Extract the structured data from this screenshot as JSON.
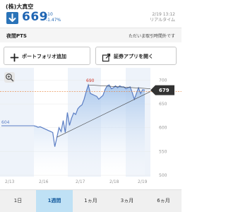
{
  "quote": {
    "company": "(株)大真空",
    "price": "669",
    "change": "-10",
    "change_pct": "-1.47%",
    "date_time": "2/19 13:12",
    "mode": "リアルタイム"
  },
  "pts": {
    "label": "夜間PTS",
    "status": "ただいま取引時間外です"
  },
  "buttons": {
    "portfolio": "ポートフォリオ追加",
    "app": "証券アプリを開く"
  },
  "chart_data": {
    "type": "line",
    "x_tick_labels": [
      "2/13",
      "2/16",
      "2/17",
      "2/18",
      "2/19"
    ],
    "y_tick_labels": [
      "700",
      "650",
      "600",
      "550",
      "500"
    ],
    "ylim": [
      500,
      720
    ],
    "series": [
      {
        "values": [
          604,
          603,
          601,
          602,
          600,
          598,
          596,
          594,
          592,
          590,
          560,
          580,
          600,
          592,
          615,
          590,
          632,
          605,
          620,
          631,
          628,
          640,
          645,
          648,
          660,
          676,
          690,
          672,
          670,
          668,
          666,
          660,
          664,
          668,
          680,
          688,
          690,
          682,
          684,
          688,
          684,
          688,
          686,
          686,
          682,
          684,
          686,
          674,
          660,
          672,
          684,
          672,
          680,
          679
        ]
      }
    ],
    "current_price": 679,
    "current_label": "679",
    "annotations": [
      {
        "label": "690",
        "value": 690
      },
      {
        "label": "604",
        "value": 604
      }
    ],
    "reference_line": 676,
    "colors": {
      "line": "#5b7ec4",
      "area_top": "#9ec0ea",
      "band": "#eef3fa",
      "reference": "#e8813a",
      "high_label": "#d0362a",
      "price_tag": "#333333"
    }
  },
  "tabs": [
    {
      "label": "1日",
      "active": false
    },
    {
      "label": "1週間",
      "active": true
    },
    {
      "label": "1ヵ月",
      "active": false
    },
    {
      "label": "3ヵ月",
      "active": false
    },
    {
      "label": "6ヵ月",
      "active": false
    }
  ],
  "colors": {
    "accent": "#1f65b3",
    "tab_active": "#bfe1f5"
  }
}
